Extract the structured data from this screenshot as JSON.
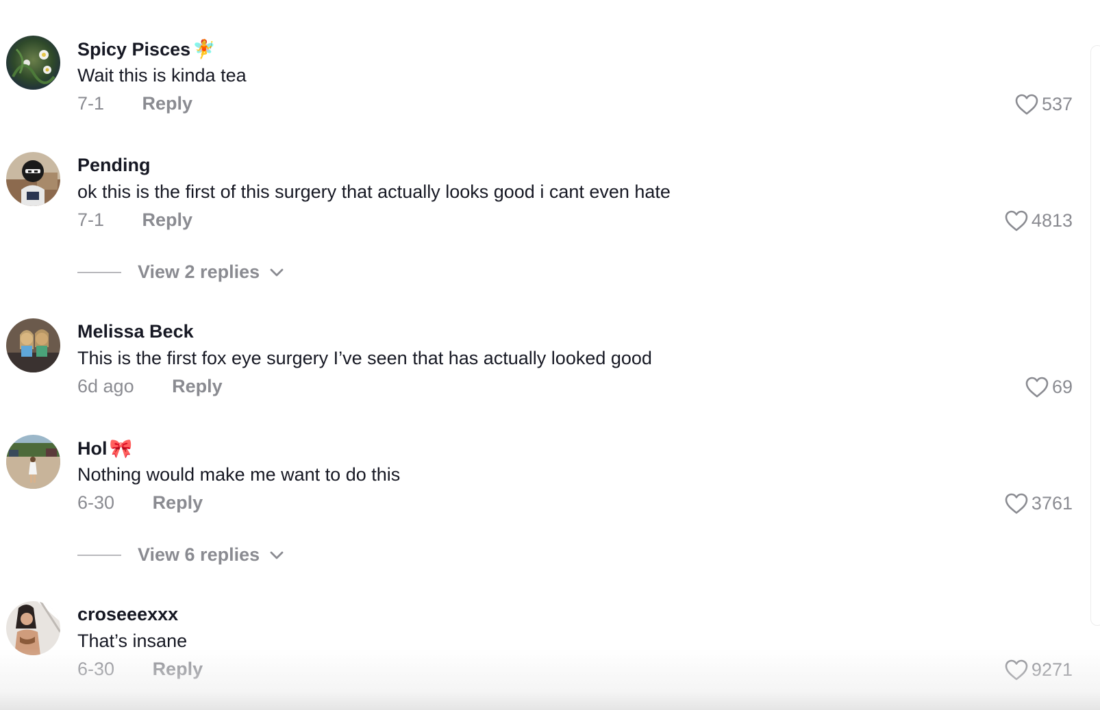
{
  "comments": [
    {
      "username": "Spicy Pisces",
      "emoji": "🧚",
      "emoji_icon": "fairy-icon",
      "text": "Wait this is kinda tea",
      "date": "7-1",
      "reply_label": "Reply",
      "likes": "537"
    },
    {
      "username": "Pending",
      "text": "ok this is the first of this surgery that actually looks good i cant even hate",
      "date": "7-1",
      "reply_label": "Reply",
      "likes": "4813",
      "view_replies": "View 2 replies"
    },
    {
      "username": "Melissa Beck",
      "text": "This is the first fox eye surgery I’ve seen that has actually looked good",
      "date": "6d ago",
      "reply_label": "Reply",
      "likes": "69"
    },
    {
      "username": "Hol",
      "emoji": "🎀",
      "emoji_icon": "ribbon-icon",
      "text": "Nothing would make me want to do this",
      "date": "6-30",
      "reply_label": "Reply",
      "likes": "3761",
      "view_replies": "View 6 replies"
    },
    {
      "username": "croseeexxx",
      "text": "That’s insane",
      "date": "6-30",
      "reply_label": "Reply",
      "likes": "9271"
    }
  ],
  "colors": {
    "primary_text": "#161823",
    "secondary_text": "#8a8b91",
    "background": "#ffffff"
  }
}
